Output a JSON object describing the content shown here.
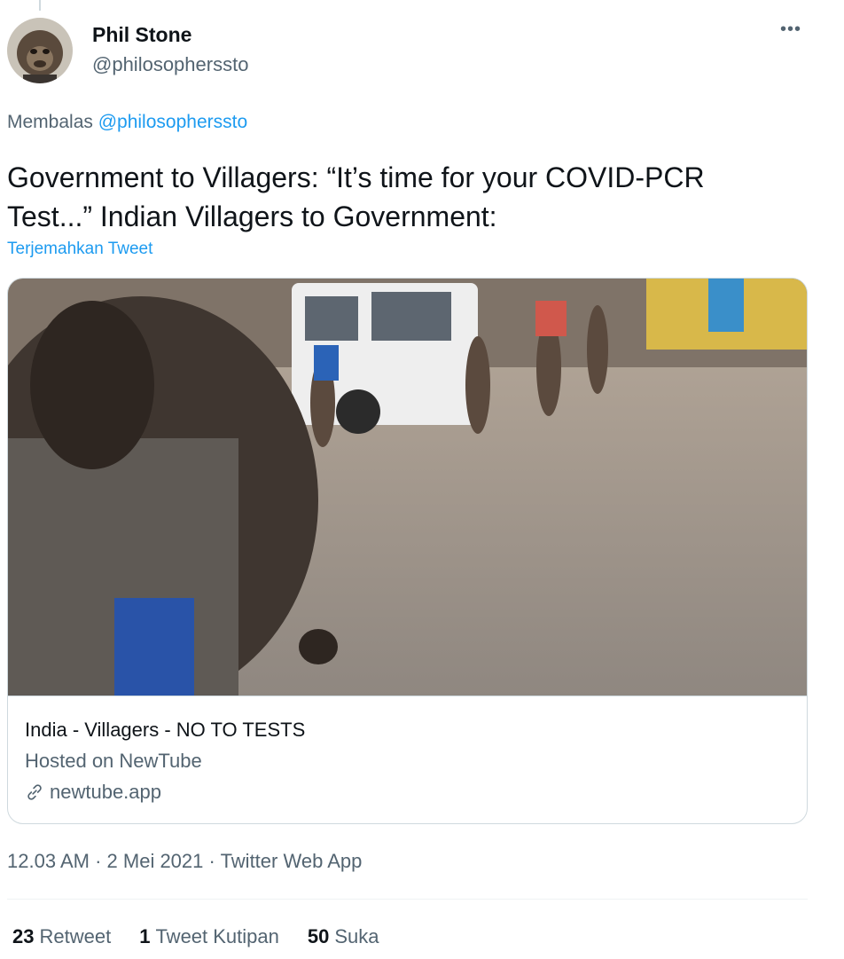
{
  "author": {
    "name": "Phil Stone",
    "handle": "@philosopherssto"
  },
  "more_label": "•••",
  "reply": {
    "prefix": "Membalas",
    "to": "@philosopherssto"
  },
  "tweet": {
    "text": "Government to Villagers: “It’s time for your COVID-PCR Test...” Indian Villagers to Government:",
    "translate_label": "Terjemahkan Tweet"
  },
  "card": {
    "title": "India - Villagers - NO TO TESTS",
    "description": "Hosted on NewTube",
    "domain": "newtube.app",
    "domain_icon": "link-icon"
  },
  "meta": {
    "time": "12.03 AM",
    "date": "2 Mei 2021",
    "source": "Twitter Web App",
    "separator": "·"
  },
  "stats": {
    "retweets_count": "23",
    "retweets_label": "Retweet",
    "quotes_count": "1",
    "quotes_label": "Tweet Kutipan",
    "likes_count": "50",
    "likes_label": "Suka"
  },
  "colors": {
    "accent": "#1d9bf0",
    "text_primary": "#0f1419",
    "text_secondary": "#536471",
    "border": "#cfd9de"
  }
}
